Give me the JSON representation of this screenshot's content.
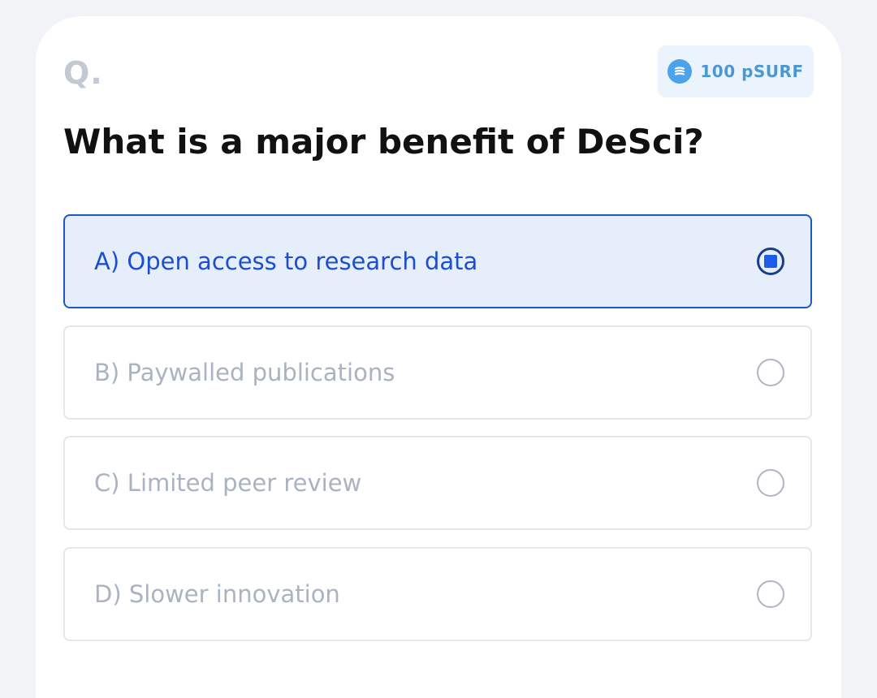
{
  "card": {
    "q_label": "Q.",
    "reward": {
      "icon": "coin-icon",
      "label": "100 pSURF"
    },
    "question": "What is a major benefit of DeSci?",
    "options": [
      {
        "label": "A) Open access to research data",
        "selected": true
      },
      {
        "label": "B) Paywalled publications",
        "selected": false
      },
      {
        "label": "C) Limited peer review",
        "selected": false
      },
      {
        "label": "D) Slower innovation",
        "selected": false
      }
    ]
  },
  "colors": {
    "accent": "#1a59c8",
    "selected_bg": "#e6eefc",
    "badge_bg": "#ebf4fc",
    "badge_text": "#4a97d4",
    "muted_text": "#a9b3c1"
  }
}
